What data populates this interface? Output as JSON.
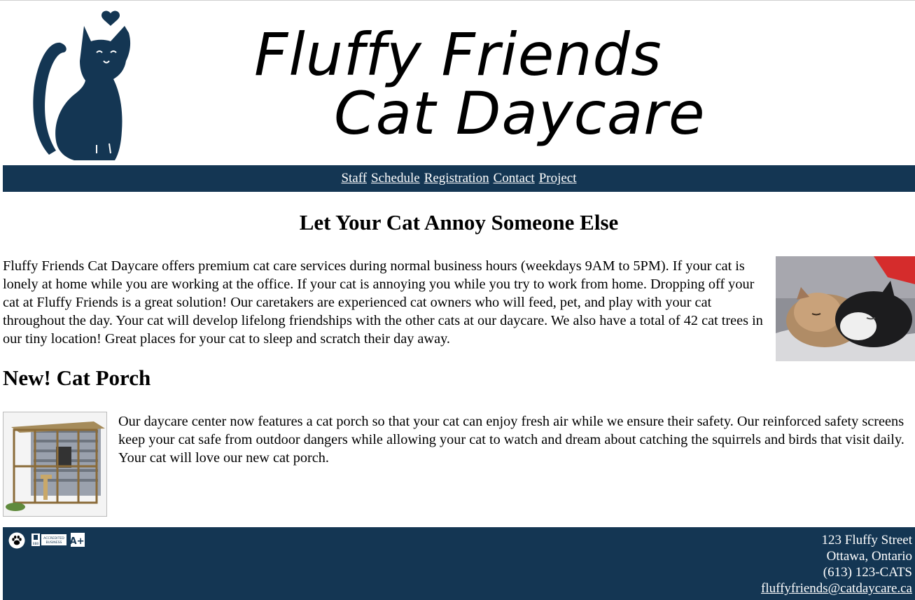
{
  "header": {
    "title_line1": "Fluffy Friends",
    "title_line2": "Cat Daycare",
    "logo_icon": "cat-silhouette-with-heart-icon"
  },
  "nav": {
    "items": [
      {
        "label": "Staff"
      },
      {
        "label": "Schedule"
      },
      {
        "label": "Registration"
      },
      {
        "label": "Contact"
      },
      {
        "label": "Project"
      }
    ]
  },
  "main": {
    "heading": "Let Your Cat Annoy Someone Else",
    "intro": "Fluffy Friends Cat Daycare offers premium cat care services during normal business hours (weekdays 9AM to 5PM). If your cat is lonely at home while you are working at the office. If your cat is annoying you while you try to work from home. Dropping off your cat at Fluffy Friends is a great solution! Our caretakers are experienced cat owners who will feed, pet, and play with your cat throughout the day. Your cat will develop lifelong friendships with the other cats at our daycare. We also have a total of 42 cat trees in our tiny location! Great places for your cat to sleep and scratch their day away.",
    "porch_heading": "New! Cat Porch",
    "porch_text": "Our daycare center now features a cat porch so that your cat can enjoy fresh air while we ensure their safety. Our reinforced safety screens keep your cat safe from outdoor dangers while allowing your cat to watch and dream about catching the squirrels and birds that visit daily. Your cat will love our new cat porch."
  },
  "footer": {
    "badges": [
      "paw-icon",
      "bbb-accredited-business-badge",
      "a-plus-rating-badge"
    ],
    "bbb_text_1": "ACCREDITED",
    "bbb_text_2": "BUSINESS",
    "bbb_text_3": "BBB",
    "rating_text": "A+",
    "address_line1": "123 Fluffy Street",
    "address_line2": "Ottawa, Ontario",
    "phone": "(613) 123-CATS",
    "email": "fluffyfriends@catdaycare.ca"
  },
  "colors": {
    "navy": "#143653",
    "white": "#ffffff"
  }
}
